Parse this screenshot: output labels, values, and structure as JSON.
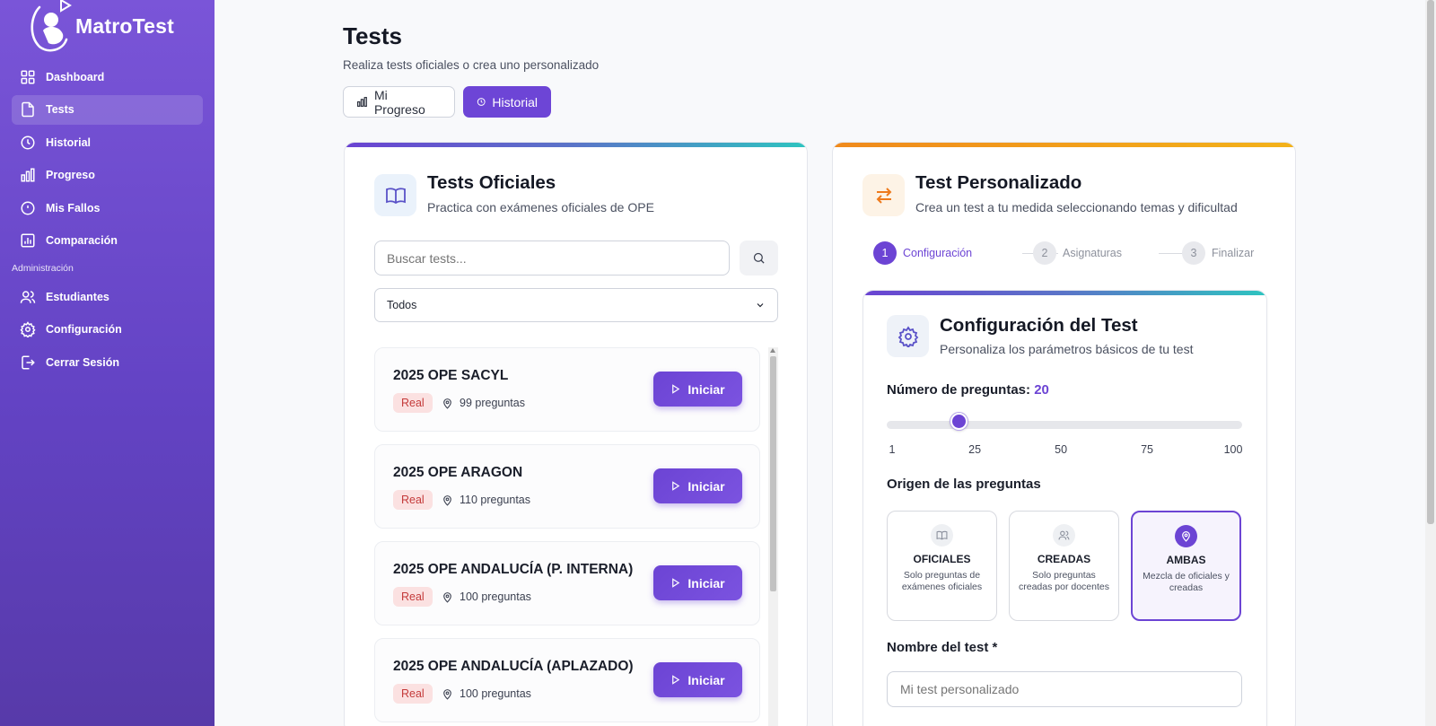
{
  "app": {
    "name": "MatroTest"
  },
  "sidebar": {
    "items": [
      {
        "label": "Dashboard",
        "icon": "grid-icon"
      },
      {
        "label": "Tests",
        "icon": "file-icon"
      },
      {
        "label": "Historial",
        "icon": "clock-icon"
      },
      {
        "label": "Progreso",
        "icon": "bar-chart-icon"
      },
      {
        "label": "Mis Fallos",
        "icon": "alert-circle-icon"
      },
      {
        "label": "Comparación",
        "icon": "chart-box-icon"
      }
    ],
    "section_label": "Administración",
    "admin_items": [
      {
        "label": "Estudiantes",
        "icon": "users-icon"
      },
      {
        "label": "Configuración",
        "icon": "gear-icon"
      },
      {
        "label": "Cerrar Sesión",
        "icon": "logout-icon"
      }
    ],
    "active": "Tests"
  },
  "header": {
    "title": "Tests",
    "subtitle": "Realiza tests oficiales o crea uno personalizado",
    "progress_button": "Mi Progreso",
    "history_button": "Historial"
  },
  "official": {
    "title": "Tests Oficiales",
    "subtitle": "Practica con exámenes oficiales de OPE",
    "search_placeholder": "Buscar tests...",
    "filter_value": "Todos",
    "start_label": "Iniciar",
    "tests": [
      {
        "name": "2025 OPE SACYL",
        "badge": "Real",
        "questions": "99 preguntas"
      },
      {
        "name": "2025 OPE ARAGON",
        "badge": "Real",
        "questions": "110 preguntas"
      },
      {
        "name": "2025 OPE ANDALUCÍA (P. INTERNA)",
        "badge": "Real",
        "questions": "100 preguntas"
      },
      {
        "name": "2025 OPE ANDALUCÍA (APLAZADO)",
        "badge": "Real",
        "questions": "100 preguntas"
      }
    ]
  },
  "custom": {
    "title": "Test Personalizado",
    "subtitle": "Crea un test a tu medida seleccionando temas y dificultad",
    "steps": [
      {
        "num": "1",
        "label": "Configuración",
        "active": true
      },
      {
        "num": "2",
        "label": "Asignaturas",
        "active": false
      },
      {
        "num": "3",
        "label": "Finalizar",
        "active": false
      }
    ],
    "config": {
      "title": "Configuración del Test",
      "subtitle": "Personaliza los parámetros básicos de tu test",
      "questions_label": "Número de preguntas:",
      "questions_value": "20",
      "slider": {
        "min": 1,
        "max": 100,
        "value": 20
      },
      "ticks": [
        "1",
        "25",
        "50",
        "75",
        "100"
      ],
      "origin_label": "Origen de las preguntas",
      "origin_options": [
        {
          "title": "OFICIALES",
          "desc": "Solo preguntas de exámenes oficiales",
          "icon": "book-icon"
        },
        {
          "title": "CREADAS",
          "desc": "Solo preguntas creadas por docentes",
          "icon": "users-icon"
        },
        {
          "title": "AMBAS",
          "desc": "Mezcla de oficiales y creadas",
          "icon": "pin-icon"
        }
      ],
      "origin_selected": "AMBAS",
      "name_label": "Nombre del test *",
      "name_placeholder": "Mi test personalizado"
    }
  },
  "colors": {
    "accent": "#6c44d4",
    "sidebar": "#6a4ad0",
    "badge_bg": "#fbe1e1",
    "badge_text": "#c43a3a",
    "orange": "#f08a1c"
  }
}
